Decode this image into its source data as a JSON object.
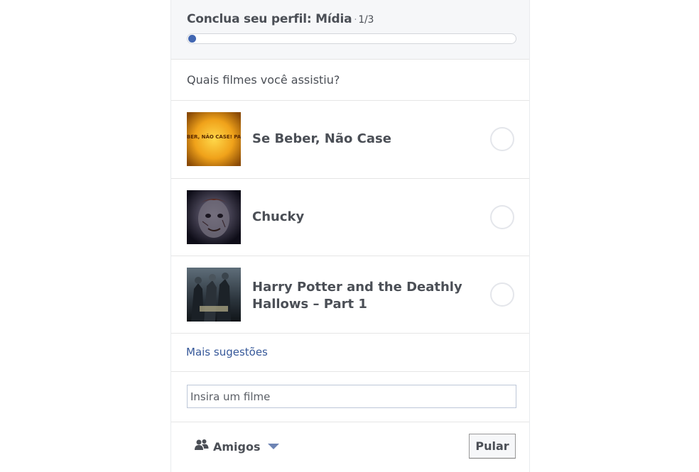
{
  "header": {
    "title": "Conclua seu perfil: Mídia",
    "separator": "·",
    "step": "1/3",
    "progress_fraction": 0.0
  },
  "question": "Quais filmes você assistiu?",
  "movies": [
    {
      "title": "Se Beber, Não Case",
      "selected": false,
      "thumb_text": "SE BEBER, NÃO CASE! PARTE II"
    },
    {
      "title": "Chucky",
      "selected": false
    },
    {
      "title": "Harry Potter and the Deathly Hallows – Part 1",
      "selected": false
    }
  ],
  "more_link": "Mais sugestões",
  "search": {
    "placeholder": "Insira um filme",
    "value": ""
  },
  "footer": {
    "audience_label": "Amigos",
    "audience_icon": "friends-icon",
    "skip_label": "Pular"
  },
  "colors": {
    "accent": "#4267b2",
    "link": "#365899",
    "text": "#4b4f56"
  }
}
